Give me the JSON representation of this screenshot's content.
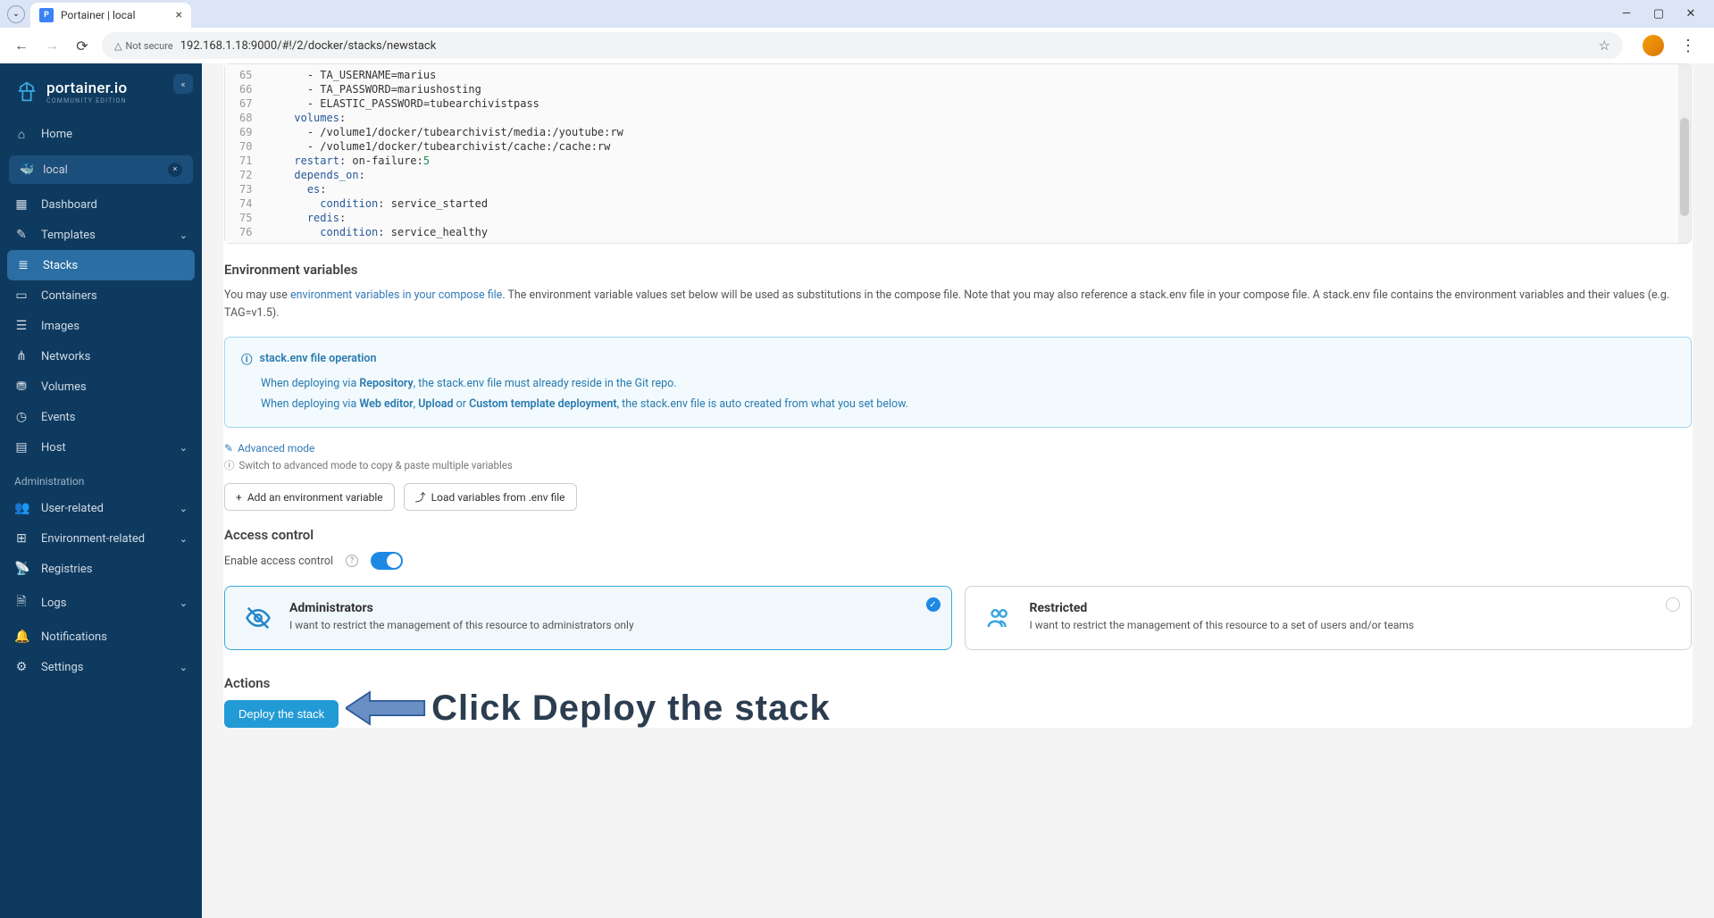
{
  "browser": {
    "tab_title": "Portainer | local",
    "security": "Not secure",
    "url": "192.168.1.18:9000/#!/2/docker/stacks/newstack"
  },
  "logo": {
    "title": "portainer.io",
    "subtitle": "COMMUNITY EDITION"
  },
  "nav": {
    "home": "Home",
    "env_name": "local",
    "dashboard": "Dashboard",
    "templates": "Templates",
    "stacks": "Stacks",
    "containers": "Containers",
    "images": "Images",
    "networks": "Networks",
    "volumes": "Volumes",
    "events": "Events",
    "host": "Host",
    "admin_section": "Administration",
    "user_related": "User-related",
    "env_related": "Environment-related",
    "registries": "Registries",
    "logs": "Logs",
    "notifications": "Notifications",
    "settings": "Settings"
  },
  "editor": {
    "line_start": 65,
    "lines": [
      {
        "n": 65,
        "indent": "      ",
        "k": "",
        "v": "- TA_USERNAME=marius"
      },
      {
        "n": 66,
        "indent": "      ",
        "k": "",
        "v": "- TA_PASSWORD=mariushosting"
      },
      {
        "n": 67,
        "indent": "      ",
        "k": "",
        "v": "- ELASTIC_PASSWORD=tubearchivistpass"
      },
      {
        "n": 68,
        "indent": "    ",
        "k": "volumes",
        "v": ":"
      },
      {
        "n": 69,
        "indent": "      ",
        "k": "",
        "v": "- /volume1/docker/tubearchivist/media:/youtube:rw"
      },
      {
        "n": 70,
        "indent": "      ",
        "k": "",
        "v": "- /volume1/docker/tubearchivist/cache:/cache:rw"
      },
      {
        "n": 71,
        "indent": "    ",
        "k": "restart",
        "v": ": on-failure:",
        "num": "5"
      },
      {
        "n": 72,
        "indent": "    ",
        "k": "depends_on",
        "v": ":"
      },
      {
        "n": 73,
        "indent": "      ",
        "k": "es",
        "v": ":"
      },
      {
        "n": 74,
        "indent": "        ",
        "k": "condition",
        "v": ": service_started"
      },
      {
        "n": 75,
        "indent": "      ",
        "k": "redis",
        "v": ":"
      },
      {
        "n": 76,
        "indent": "        ",
        "k": "condition",
        "v": ": service_healthy"
      }
    ]
  },
  "env_section": {
    "title": "Environment variables",
    "desc_pre": "You may use ",
    "desc_link": "environment variables in your compose file",
    "desc_post": ". The environment variable values set below will be used as substitutions in the compose file. Note that you may also reference a stack.env file in your compose file. A stack.env file contains the environment variables and their values (e.g. TAG=v1.5).",
    "info_title": "stack.env file operation",
    "info_l1a": "When deploying via ",
    "info_l1b": "Repository",
    "info_l1c": ", the stack.env file must already reside in the Git repo.",
    "info_l2a": "When deploying via ",
    "info_l2b": "Web editor",
    "info_l2c": ", ",
    "info_l2d": "Upload",
    "info_l2e": " or ",
    "info_l2f": "Custom template deployment",
    "info_l2g": ", the stack.env file is auto created from what you set below.",
    "adv_link": "Advanced mode",
    "adv_hint": "Switch to advanced mode to copy & paste multiple variables",
    "btn_add": "Add an environment variable",
    "btn_load": "Load variables from .env file"
  },
  "access": {
    "title": "Access control",
    "enable_label": "Enable access control",
    "admin_title": "Administrators",
    "admin_sub": "I want to restrict the management of this resource to administrators only",
    "restricted_title": "Restricted",
    "restricted_sub": "I want to restrict the management of this resource to a set of users and/or teams"
  },
  "actions": {
    "title": "Actions",
    "deploy": "Deploy the stack"
  },
  "annotation": "Click Deploy the stack"
}
